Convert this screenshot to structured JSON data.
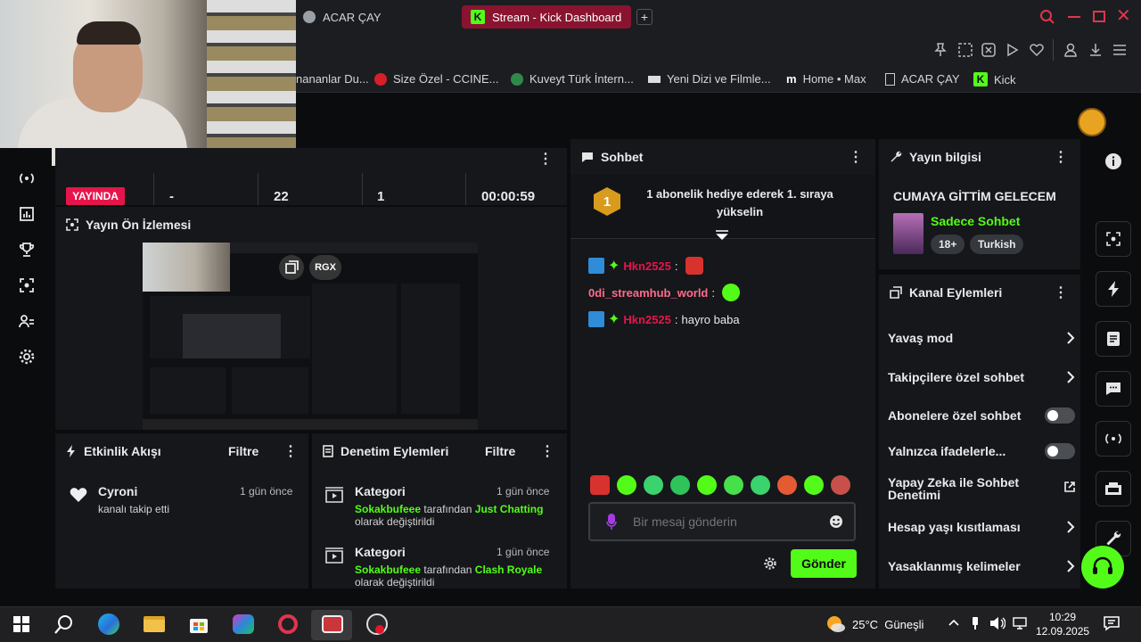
{
  "browser": {
    "tabs": [
      {
        "label": "ACAR ÇAY"
      },
      {
        "label": "Stream - Kick Dashboard"
      }
    ],
    "new_tab_symbol": "+",
    "bookmarks": [
      {
        "label": "nananlar Du..."
      },
      {
        "label": "Size Özel - CCINE..."
      },
      {
        "label": "Kuveyt Türk İntern..."
      },
      {
        "label": "Yeni Dizi ve Filmle..."
      },
      {
        "label": "Home • Max"
      },
      {
        "label": "ACAR ÇAY"
      },
      {
        "label": "Kick"
      }
    ]
  },
  "stats": {
    "status_badge": "YAYINDA",
    "viewers": "-",
    "followers": "22",
    "subs": "1",
    "uptime": "00:00:59"
  },
  "preview": {
    "title": "Yayın Ön İzlemesi",
    "overlay_label": "RGX"
  },
  "activity": {
    "title": "Etkinlik Akışı",
    "filter_label": "Filtre",
    "items": [
      {
        "user": "Cyroni",
        "text": "kanalı takip etti",
        "time": "1 gün önce"
      }
    ]
  },
  "moderation": {
    "title": "Denetim Eylemleri",
    "filter_label": "Filtre",
    "items": [
      {
        "title": "Kategori",
        "time": "1 gün önce",
        "user": "Sokakbufeee",
        "mid": "tarafından",
        "category": "Just Chatting",
        "suffix": "olarak değiştirildi"
      },
      {
        "title": "Kategori",
        "time": "1 gün önce",
        "user": "Sokakbufeee",
        "mid": "tarafından",
        "category": "Clash Royale",
        "suffix": "olarak değiştirildi"
      }
    ]
  },
  "chat": {
    "title": "Sohbet",
    "pinned_rank": "1",
    "pinned_text": "1 abonelik hediye ederek 1. sıraya yükselin",
    "messages": [
      {
        "user": "Hkn2525",
        "sep": ":",
        "text": ""
      },
      {
        "user": "0di_streamhub_world",
        "sep": ":",
        "text": ""
      },
      {
        "user": "Hkn2525",
        "sep": ":",
        "text": "hayro baba"
      }
    ],
    "input_placeholder": "Bir mesaj gönderin",
    "send_label": "Gönder"
  },
  "stream_info": {
    "title": "Yayın bilgisi",
    "stream_title": "CUMAYA GİTTİM GELECEM",
    "category": "Sadece Sohbet",
    "tags": [
      "18+",
      "Turkish"
    ]
  },
  "channel_actions": {
    "title": "Kanal Eylemleri",
    "items": [
      {
        "label": "Yavaş mod",
        "control": "chevron"
      },
      {
        "label": "Takipçilere özel sohbet",
        "control": "chevron"
      },
      {
        "label": "Abonelere özel sohbet",
        "control": "toggle"
      },
      {
        "label": "Yalnızca ifadelerle...",
        "control": "toggle"
      },
      {
        "label": "Yapay Zeka ile Sohbet Denetimi",
        "control": "external"
      },
      {
        "label": "Hesap yaşı kısıtlaması",
        "control": "chevron"
      },
      {
        "label": "Yasaklanmış kelimeler",
        "control": "chevron"
      }
    ]
  },
  "taskbar": {
    "weather": "25°C  Güneşli",
    "time": "10:29",
    "date": "12.09.2025"
  },
  "colors": {
    "kick_green": "#53fc18",
    "live_red": "#e5154b",
    "username_red": "#e5154b",
    "username_pink": "#ff6b8a",
    "tab_active": "#8a1430"
  }
}
